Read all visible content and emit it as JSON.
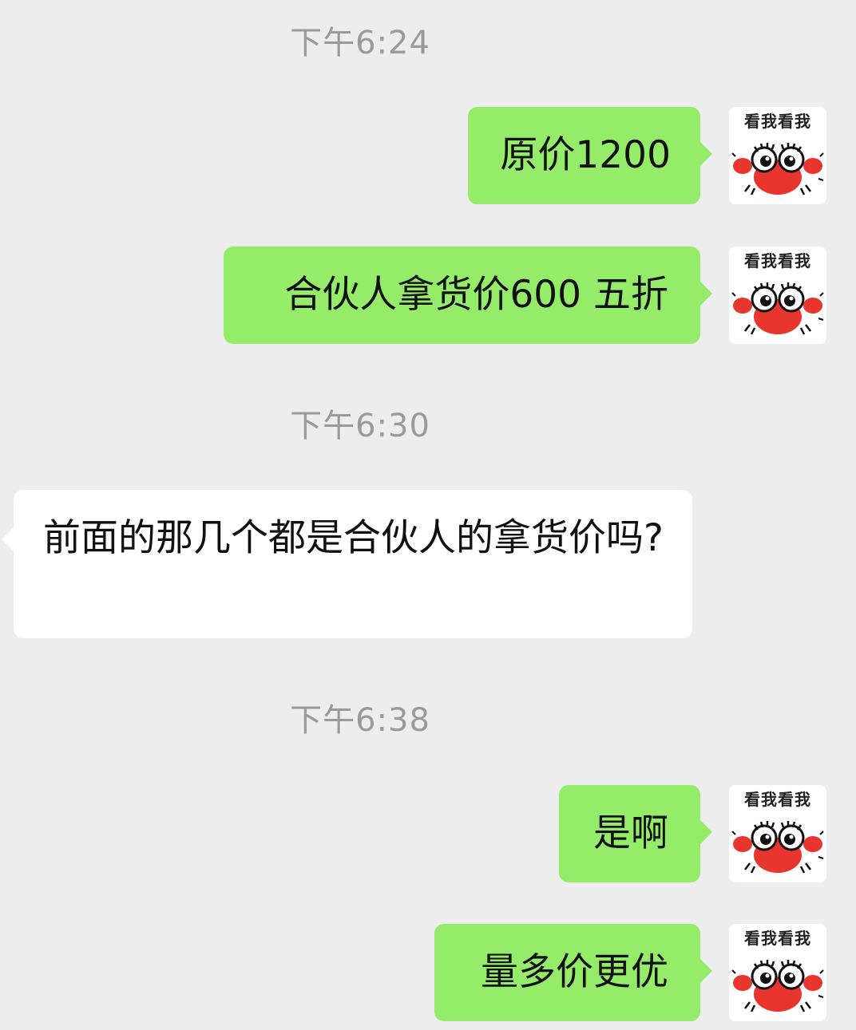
{
  "chat": {
    "timestamps": [
      "下午6:24",
      "下午6:30",
      "下午6:38"
    ],
    "messages": [
      {
        "direction": "out",
        "text": "原价1200"
      },
      {
        "direction": "out",
        "text": "合伙人拿货价600 五折"
      },
      {
        "direction": "in",
        "text": "前面的那几个都是合伙人的拿货价吗?"
      },
      {
        "direction": "out",
        "text": "是啊"
      },
      {
        "direction": "out",
        "text": "量多价更优"
      }
    ],
    "avatar": {
      "caption": "看我看我",
      "icon": "crab-sticker-icon"
    }
  },
  "colors": {
    "background": "#ededed",
    "outgoing_bubble": "#95ec69",
    "incoming_bubble": "#ffffff",
    "timestamp_text": "#9a9a9a",
    "crab_red": "#e8352e"
  }
}
